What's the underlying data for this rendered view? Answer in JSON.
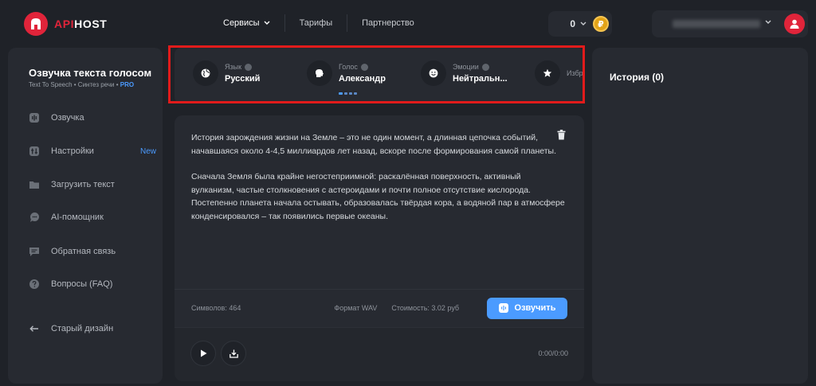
{
  "brand": {
    "part1": "API",
    "part2": "HOST"
  },
  "nav": {
    "services": "Сервисы",
    "pricing": "Тарифы",
    "partnership": "Партнерство"
  },
  "balance": {
    "value": "0",
    "coin": "₽"
  },
  "sidebar": {
    "title": "Озвучка текста голосом",
    "subtitle": "Text To Speech • Синтез речи •",
    "pro": "PRO",
    "items": [
      {
        "label": "Озвучка"
      },
      {
        "label": "Настройки",
        "badge": "New"
      },
      {
        "label": "Загрузить текст"
      },
      {
        "label": "AI-помощник"
      },
      {
        "label": "Обратная связь"
      },
      {
        "label": "Вопросы (FAQ)"
      },
      {
        "label": "Старый дизайн"
      }
    ]
  },
  "settings": {
    "language": {
      "label": "Язык",
      "value": "Русский"
    },
    "voice": {
      "label": "Голос",
      "value": "Александр"
    },
    "emotion": {
      "label": "Эмоции",
      "value": "Нейтральн..."
    },
    "favorite": {
      "label": "Избр"
    }
  },
  "editor": {
    "paragraph1": "История зарождения жизни на Земле – это не один момент, а длинная цепочка событий, начавшаяся около 4-4,5 миллиардов лет назад, вскоре после формирования самой планеты.",
    "paragraph2": "Сначала Земля была крайне негостеприимной: раскалённая поверхность, активный вулканизм, частые столкновения с астероидами и почти полное отсутствие кислорода. Постепенно планета начала остывать, образовалась твёрдая кора, а водяной пар в атмосфере конденсировался – так появились первые океаны.",
    "chars": "Символов: 464",
    "format": "Формат WAV",
    "cost": "Стоимость: 3.02 руб",
    "speak_label": "Озвучить"
  },
  "player": {
    "time": "0:00/0:00"
  },
  "history": {
    "title": "История (0)"
  },
  "colors": {
    "accent": "#4b9bff",
    "brand": "#e0243a",
    "highlight": "#e11b1b"
  }
}
